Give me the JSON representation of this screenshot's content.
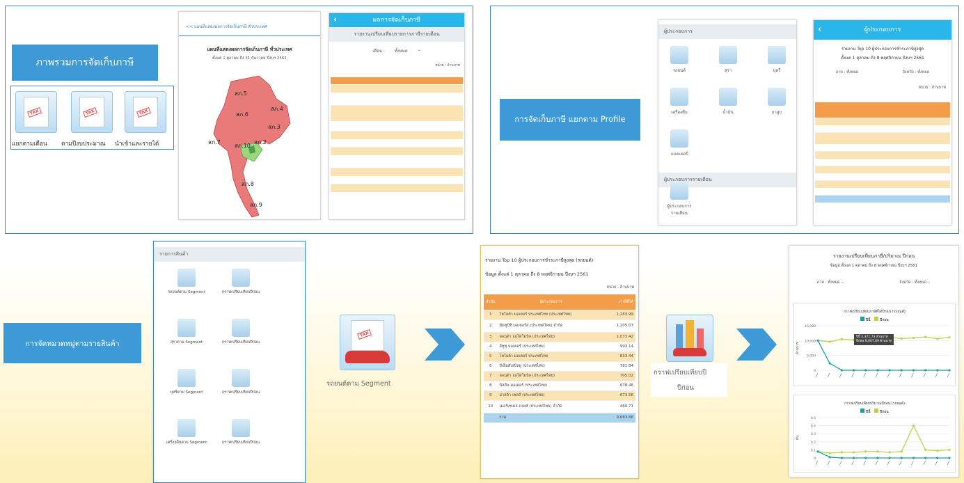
{
  "labels": {
    "overview": "ภาพรวมการจัดเก็บภาษี",
    "profile": "การจัดเก็บภาษี แยกตาม Profile",
    "category": "การจัดหมวดหมู่ตามรายสินค้า"
  },
  "overview_icons": [
    "แยกตามเดือน",
    "ตามปีงบประมาณ",
    "นำเข้าและรายได้"
  ],
  "map_card": {
    "header": "<< แผนที่แสดงผลการจัดเก็บภาษี ทั่วประเทศ",
    "title": "แผนที่แสดงผลการจัดเก็บภาษี ทั่วประเทศ",
    "subtitle": "ตั้งแต่ 1 ตุลาคม ถึง 31 ธันวาคม ปีงบฯ 2561",
    "regions": [
      "สภ.1",
      "สภ.2",
      "สภ.3",
      "สภ.4",
      "สภ.5",
      "สภ.6",
      "สภ.7",
      "สภ.8",
      "สภ.9",
      "สภ.10"
    ]
  },
  "phone_report": {
    "header": "ผลการจัดเก็บภาษี",
    "title": "รายงานเปรียบเทียบรายการภาษีรายเดือน",
    "filter": "เดือน :",
    "filter_value": "ทั้งหมด",
    "unit": "หน่วย : ล้านบาท"
  },
  "tax_icon": {
    "doc": "TAX",
    "stamp": "TAX"
  },
  "profile_phone": {
    "section1": "ผู้ประกอบการ",
    "items": [
      "รถยนต์",
      "สุรา",
      "บุหรี่",
      "เครื่องดื่ม",
      "น้ำมัน",
      "ยาสูบ",
      "แบตเตอรี่"
    ],
    "section2": "ผู้ประกอบการรายเดือน",
    "sub_item": "ผู้ประกอบการรายเดือน"
  },
  "top10_phone": {
    "header": "ผู้ประกอบการ",
    "title": "รายงาน Top 10 ผู้ประกอบการชำระภาษีสูงสุด",
    "subtitle": "ตั้งแต่ 1 ตุลาคม ถึง 8 พฤศจิกายน ปีงบฯ 2561",
    "filter1": "ภาค :",
    "filter1_value": "ทั้งหมด",
    "filter2": "จังหวัด :",
    "filter2_value": "ทั้งหมด",
    "unit_label": "หน่วย :",
    "unit_value": "ล้านบาท"
  },
  "category_phone": {
    "header": "รายการสินค้า",
    "items": [
      "รถยนต์ตาม Segment",
      "กราฟเปรียบเทียบปีก่อน",
      "สุราตาม Segment",
      "กราฟเปรียบเทียบปีก่อน",
      "บุหรี่ตาม Segment",
      "กราฟเปรียบเทียบปีก่อน",
      "เครื่องดื่มตาม Segment",
      "กราฟเปรียบเทียบปีก่อน"
    ]
  },
  "segment_icon_caption": "รถยนต์ตาม Segment",
  "compare_icon_caption1": "กราฟเปรียบเทียบปี",
  "compare_icon_caption2": "ปีก่อน",
  "top10_card": {
    "title": "รายงาน Top 10 ผู้ประกอบการชำระภาษีสูงสุด (รถยนต์)",
    "subtitle": "ข้อมูล ตั้งแต่ 1 ตุลาคม ถึง 8 พฤศจิกายน ปีงบฯ 2561",
    "unit": "หน่วย : ล้านบาท",
    "col_rank": "ลำดับ",
    "col_name": "ผู้ประกอบการ",
    "col_value": "ภาษีที่ได้",
    "rows": [
      {
        "rank": "1",
        "name": "โตโยต้า มอเตอร์ ประเทศไทย (ประเทศไทย)",
        "value": "1,283.99"
      },
      {
        "rank": "2",
        "name": "มิตซูบิชิ มอเตอร์ส (ประเทศไทย) จำกัด",
        "value": "1,205.07"
      },
      {
        "rank": "3",
        "name": "ฮอนด้า ออโตโมบิล (ประเทศไทย)",
        "value": "1,073.42"
      },
      {
        "rank": "4",
        "name": "อีซูซุ มอเตอร์ (ประเทศไทย)",
        "value": "993.14"
      },
      {
        "rank": "5",
        "name": "โตโยต้า มอเตอร์ ประเทศไทย",
        "value": "833.44"
      },
      {
        "rank": "6",
        "name": "บีเอ็มดับเบิลยู (ประเทศไทย)",
        "value": "781.84"
      },
      {
        "rank": "7",
        "name": "ฮอนด้า ออโตโมบิล (ประเทศไทย)",
        "value": "705.02"
      },
      {
        "rank": "8",
        "name": "นิสสัน มอเตอร์ (ประเทศไทย)",
        "value": "678.46"
      },
      {
        "rank": "9",
        "name": "มาสด้า เซลส์ (ประเทศไทย)",
        "value": "673.56"
      },
      {
        "rank": "10",
        "name": "เมอร์เซเดส-เบนซ์ (ประเทศไทย) จำกัด",
        "value": "460.71"
      }
    ],
    "total_label": "รวม",
    "total_value": "9,683.66"
  },
  "compare_card": {
    "title": "รายงานเปรียบเทียบภาษี/ปริมาณ ปีก่อน",
    "subtitle": "ข้อมูล ตั้งแต่ 1 ตุลาคม ถึง 8 พฤศจิกายน ปีงบฯ 2561",
    "filter1": "ภาค :",
    "filter1_value": "ทั้งหมด",
    "filter2": "จังหวัด :",
    "filter2_value": "ทั้งหมด",
    "chart1_title": "กราฟเปรียบเทียบภาษีที่ได้ปีก่อน (รถยนต์)",
    "chart2_title": "กราฟเปรียบเทียบปริมาณปีก่อน (รถยนต์)",
    "legend_this": "ปีนี้",
    "legend_prev": "ปีก่อน",
    "y1_label": "ล้านบาท",
    "y2_label": "คัน",
    "tooltip_line1": "ปีนี้ 2,371.73 ล้านบาท",
    "tooltip_line2": "ปีก่อน 9,607.69 ล้านบาท",
    "colors": {
      "this": "#1aa0a0",
      "prev": "#b8d64a"
    }
  },
  "chart_data": [
    {
      "type": "line",
      "title": "กราฟเปรียบเทียบภาษีที่ได้ปีก่อน (รถยนต์)",
      "ylabel": "ล้านบาท",
      "ylim": [
        0,
        15000
      ],
      "y_ticks": [
        "15,000",
        "10,000",
        "5,000",
        "0"
      ],
      "series": [
        {
          "name": "ปีนี้",
          "values": [
            10000,
            2300,
            0,
            0,
            0,
            0,
            0,
            0,
            0,
            0,
            0,
            0
          ]
        },
        {
          "name": "ปีก่อน",
          "values": [
            10000,
            9600,
            10500,
            10200,
            10800,
            10600,
            11000,
            10700,
            10900,
            11200,
            10600,
            11100
          ]
        }
      ]
    },
    {
      "type": "line",
      "title": "กราฟเปรียบเทียบปริมาณปีก่อน (รถยนต์)",
      "ylabel": "คัน",
      "ylim": [
        0,
        0.5
      ],
      "y_ticks": [
        "0.5",
        "0.4",
        "0.3",
        "0.2",
        "0.1",
        "0"
      ],
      "series": [
        {
          "name": "ปีนี้",
          "values": [
            0.08,
            0.01,
            0,
            0,
            0,
            0,
            0,
            0,
            0,
            0,
            0,
            0
          ]
        },
        {
          "name": "ปีก่อน",
          "values": [
            0.08,
            0.06,
            0.07,
            0.07,
            0.08,
            0.08,
            0.07,
            0.08,
            0.4,
            0.1,
            0.09,
            0.1
          ]
        }
      ]
    }
  ]
}
